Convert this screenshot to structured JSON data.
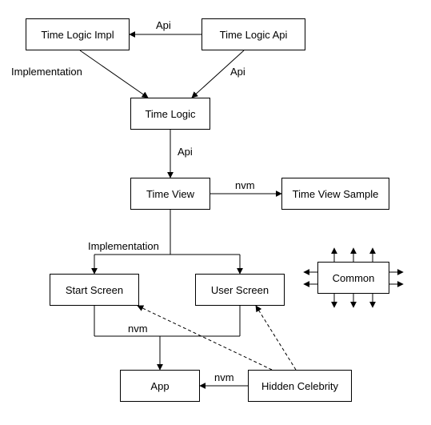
{
  "nodes": {
    "time_logic_impl": "Time Logic Impl",
    "time_logic_api": "Time Logic Api",
    "time_logic": "Time Logic",
    "time_view": "Time View",
    "time_view_sample": "Time View Sample",
    "start_screen": "Start Screen",
    "user_screen": "User Screen",
    "common": "Common",
    "app": "App",
    "hidden_celebrity": "Hidden Celebrity"
  },
  "edges": {
    "api_top": "Api",
    "implementation_left": "Implementation",
    "api_right": "Api",
    "api_mid": "Api",
    "nvm_right": "nvm",
    "implementation_mid": "Implementation",
    "nvm_lower": "nvm",
    "nvm_bottom": "nvm"
  },
  "chart_data": {
    "type": "diagram",
    "title": "",
    "nodes": [
      {
        "id": "time_logic_impl",
        "label": "Time Logic Impl"
      },
      {
        "id": "time_logic_api",
        "label": "Time Logic Api"
      },
      {
        "id": "time_logic",
        "label": "Time Logic"
      },
      {
        "id": "time_view",
        "label": "Time View"
      },
      {
        "id": "time_view_sample",
        "label": "Time View Sample"
      },
      {
        "id": "start_screen",
        "label": "Start Screen"
      },
      {
        "id": "user_screen",
        "label": "User Screen"
      },
      {
        "id": "common",
        "label": "Common"
      },
      {
        "id": "app",
        "label": "App"
      },
      {
        "id": "hidden_celebrity",
        "label": "Hidden Celebrity"
      }
    ],
    "edges": [
      {
        "from": "time_logic_api",
        "to": "time_logic_impl",
        "label": "Api",
        "style": "solid"
      },
      {
        "from": "time_logic_impl",
        "to": "time_logic",
        "label": "Implementation",
        "style": "solid"
      },
      {
        "from": "time_logic_api",
        "to": "time_logic",
        "label": "Api",
        "style": "solid"
      },
      {
        "from": "time_logic",
        "to": "time_view",
        "label": "Api",
        "style": "solid"
      },
      {
        "from": "time_view",
        "to": "time_view_sample",
        "label": "nvm",
        "style": "solid"
      },
      {
        "from": "time_view",
        "to": "start_screen",
        "label": "Implementation",
        "style": "solid"
      },
      {
        "from": "time_view",
        "to": "user_screen",
        "label": "",
        "style": "solid"
      },
      {
        "from": "start_screen",
        "to": "app",
        "label": "nvm",
        "style": "solid"
      },
      {
        "from": "user_screen",
        "to": "app",
        "label": "",
        "style": "solid"
      },
      {
        "from": "hidden_celebrity",
        "to": "app",
        "label": "nvm",
        "style": "solid"
      },
      {
        "from": "hidden_celebrity",
        "to": "start_screen",
        "label": "",
        "style": "dashed"
      },
      {
        "from": "hidden_celebrity",
        "to": "user_screen",
        "label": "",
        "style": "dashed"
      },
      {
        "from": "common",
        "to": "",
        "label": "",
        "style": "solid",
        "note": "outgoing arrows to all directions"
      }
    ]
  }
}
